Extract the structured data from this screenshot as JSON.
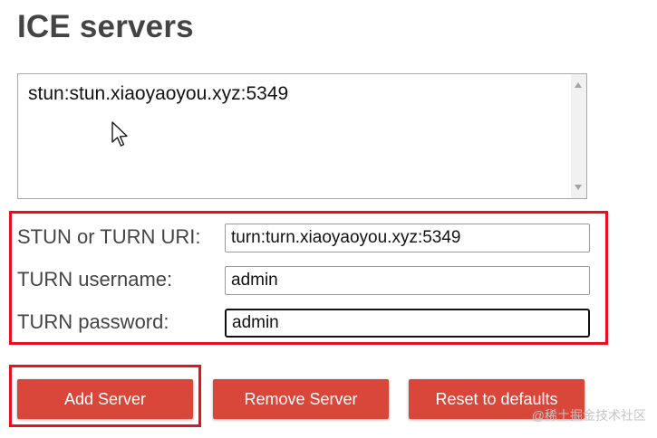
{
  "page": {
    "title": "ICE servers"
  },
  "server_list": {
    "items": [
      "stun:stun.xiaoyaoyou.xyz:5349"
    ]
  },
  "form": {
    "uri_label": "STUN or TURN URI:",
    "uri_value": "turn:turn.xiaoyaoyou.xyz:5349",
    "username_label": "TURN username:",
    "username_value": "admin",
    "password_label": "TURN password:",
    "password_value": "admin"
  },
  "buttons": {
    "add": "Add Server",
    "remove": "Remove Server",
    "reset": "Reset to defaults"
  },
  "watermark": "@稀土掘金技术社区",
  "colors": {
    "button_bg": "#d9473b",
    "highlight": "#e8111b"
  }
}
